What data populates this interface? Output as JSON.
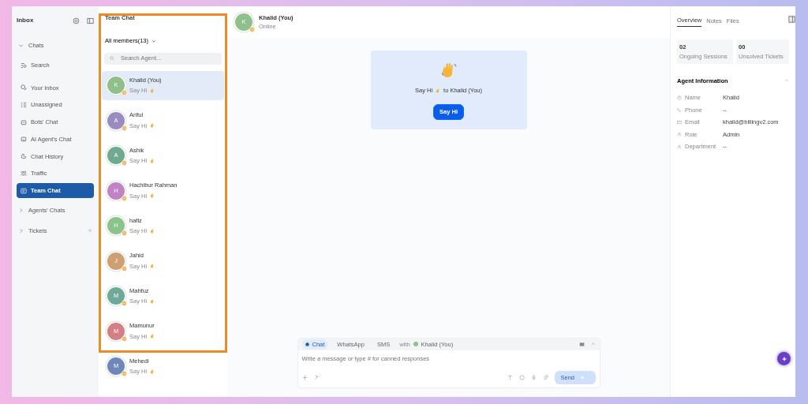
{
  "sidebar": {
    "title": "Inbox",
    "items": [
      {
        "kind": "group",
        "label": "Chats",
        "expanded": true,
        "children": [
          {
            "label": "Search",
            "selected": false
          },
          {
            "label": "Your Inbox",
            "selected": false
          },
          {
            "label": "Unassigned",
            "selected": false
          },
          {
            "label": "Bots' Chat",
            "selected": false
          },
          {
            "label": "AI Agent's Chat",
            "selected": false
          },
          {
            "label": "Chat History",
            "selected": false
          },
          {
            "label": "Traffic",
            "selected": false
          },
          {
            "label": "Team Chat",
            "selected": true
          }
        ]
      },
      {
        "kind": "group",
        "label": "Agents' Chats",
        "expanded": false
      },
      {
        "kind": "group",
        "label": "Tickets",
        "expanded": false,
        "addable": true
      }
    ]
  },
  "member_list": {
    "title": "Team Chat",
    "filter": "All members(13)",
    "search": {
      "placeholder": "Search Agent..."
    },
    "members": [
      {
        "name": "Khalid (You)",
        "initial": "K",
        "color": "#8fbf8a",
        "preview": "Say Hi",
        "selected": true
      },
      {
        "name": "Ariful",
        "initial": "A",
        "color": "#9a8cc0",
        "preview": "Say Hi",
        "selected": false
      },
      {
        "name": "Ashik",
        "initial": "A",
        "color": "#6fa98f",
        "preview": "Say Hi",
        "selected": false
      },
      {
        "name": "Hachibur Rahman",
        "initial": "H",
        "color": "#c083c4",
        "preview": "Say Hi",
        "selected": false
      },
      {
        "name": "hafiz",
        "initial": "H",
        "color": "#8cc28c",
        "preview": "Say Hi",
        "selected": false
      },
      {
        "name": "Jahid",
        "initial": "J",
        "color": "#cf9f72",
        "preview": "Say Hi",
        "selected": false
      },
      {
        "name": "Mahfuz",
        "initial": "M",
        "color": "#6fa99a",
        "preview": "Say Hi",
        "selected": false
      },
      {
        "name": "Mamunur",
        "initial": "M",
        "color": "#d47f86",
        "preview": "Say Hi",
        "selected": false
      },
      {
        "name": "Mehedi",
        "initial": "M",
        "color": "#6e86b8",
        "preview": "Say Hi",
        "selected": false
      }
    ]
  },
  "chat": {
    "header": {
      "name": "Khalid (You)",
      "initial": "K",
      "status": "Online"
    },
    "greeting": {
      "before": "Say Hi",
      "after": "to Khalid (You)",
      "button": "Say Hi"
    },
    "composer": {
      "tabs": [
        {
          "label": "Chat",
          "selected": true
        },
        {
          "label": "WhatsApp",
          "selected": false
        },
        {
          "label": "SMS",
          "selected": false
        }
      ],
      "with_label": "with",
      "recipient": "Khalid (You)",
      "placeholder": "Write a message or type # for canned responses",
      "send": {
        "label": "Send",
        "disabled": true
      }
    }
  },
  "details": {
    "tabs": [
      {
        "label": "Overview",
        "selected": true
      },
      {
        "label": "Notes",
        "selected": false
      },
      {
        "label": "Files",
        "selected": false
      }
    ],
    "stats": [
      {
        "value": "02",
        "label": "Ongoing Sessions"
      },
      {
        "value": "00",
        "label": "Unsolved Tickets"
      }
    ],
    "section": {
      "title": "Agent Information",
      "expanded": true,
      "fields": [
        {
          "label": "Name",
          "value": "Khalid"
        },
        {
          "label": "Phone",
          "value": "--"
        },
        {
          "label": "Email",
          "value": "khalid@billingv2.com"
        },
        {
          "label": "Role",
          "value": "Admin"
        },
        {
          "label": "Department",
          "value": "--"
        }
      ]
    }
  }
}
